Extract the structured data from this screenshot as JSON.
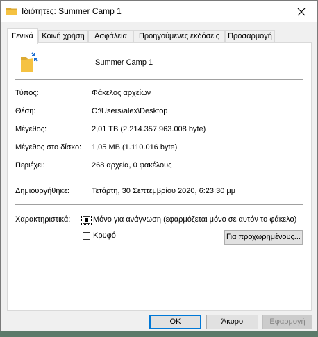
{
  "window": {
    "title": "Ιδιότητες: Summer Camp 1",
    "close_icon": "close-icon"
  },
  "tabs": [
    {
      "label": "Γενικά",
      "active": true
    },
    {
      "label": "Κοινή χρήση",
      "active": false
    },
    {
      "label": "Ασφάλεια",
      "active": false
    },
    {
      "label": "Προηγούμενες εκδόσεις",
      "active": false
    },
    {
      "label": "Προσαρμογή",
      "active": false
    }
  ],
  "general": {
    "folder_name": "Summer Camp 1",
    "rows": [
      {
        "label": "Τύπος:",
        "value": "Φάκελος αρχείων"
      },
      {
        "label": "Θέση:",
        "value": "C:\\Users\\alex\\Desktop"
      },
      {
        "label": "Μέγεθος:",
        "value": "2,01 TB (2.214.357.963.008 byte)"
      },
      {
        "label": "Μέγεθος στο δίσκο:",
        "value": "1,05 MB (1.110.016 byte)"
      },
      {
        "label": "Περιέχει:",
        "value": "268 αρχεία, 0 φακέλους"
      }
    ],
    "created_label": "Δημιουργήθηκε:",
    "created_value": "Τετάρτη, 30 Σεπτεμβρίου 2020, 6:23:30 μμ",
    "attributes_label": "Χαρακτηριστικά:",
    "readonly_label": "Μόνο για ανάγνωση (εφαρμόζεται μόνο σε αυτόν το φάκελο)",
    "readonly_checked": "indeterminate",
    "hidden_label": "Κρυφό",
    "hidden_checked": false,
    "advanced_button": "Για προχωρημένους..."
  },
  "buttons": {
    "ok": "OK",
    "cancel": "Άκυρο",
    "apply": "Εφαρμογή"
  },
  "colors": {
    "folder": "#f5c242",
    "accent": "#0078d7"
  }
}
